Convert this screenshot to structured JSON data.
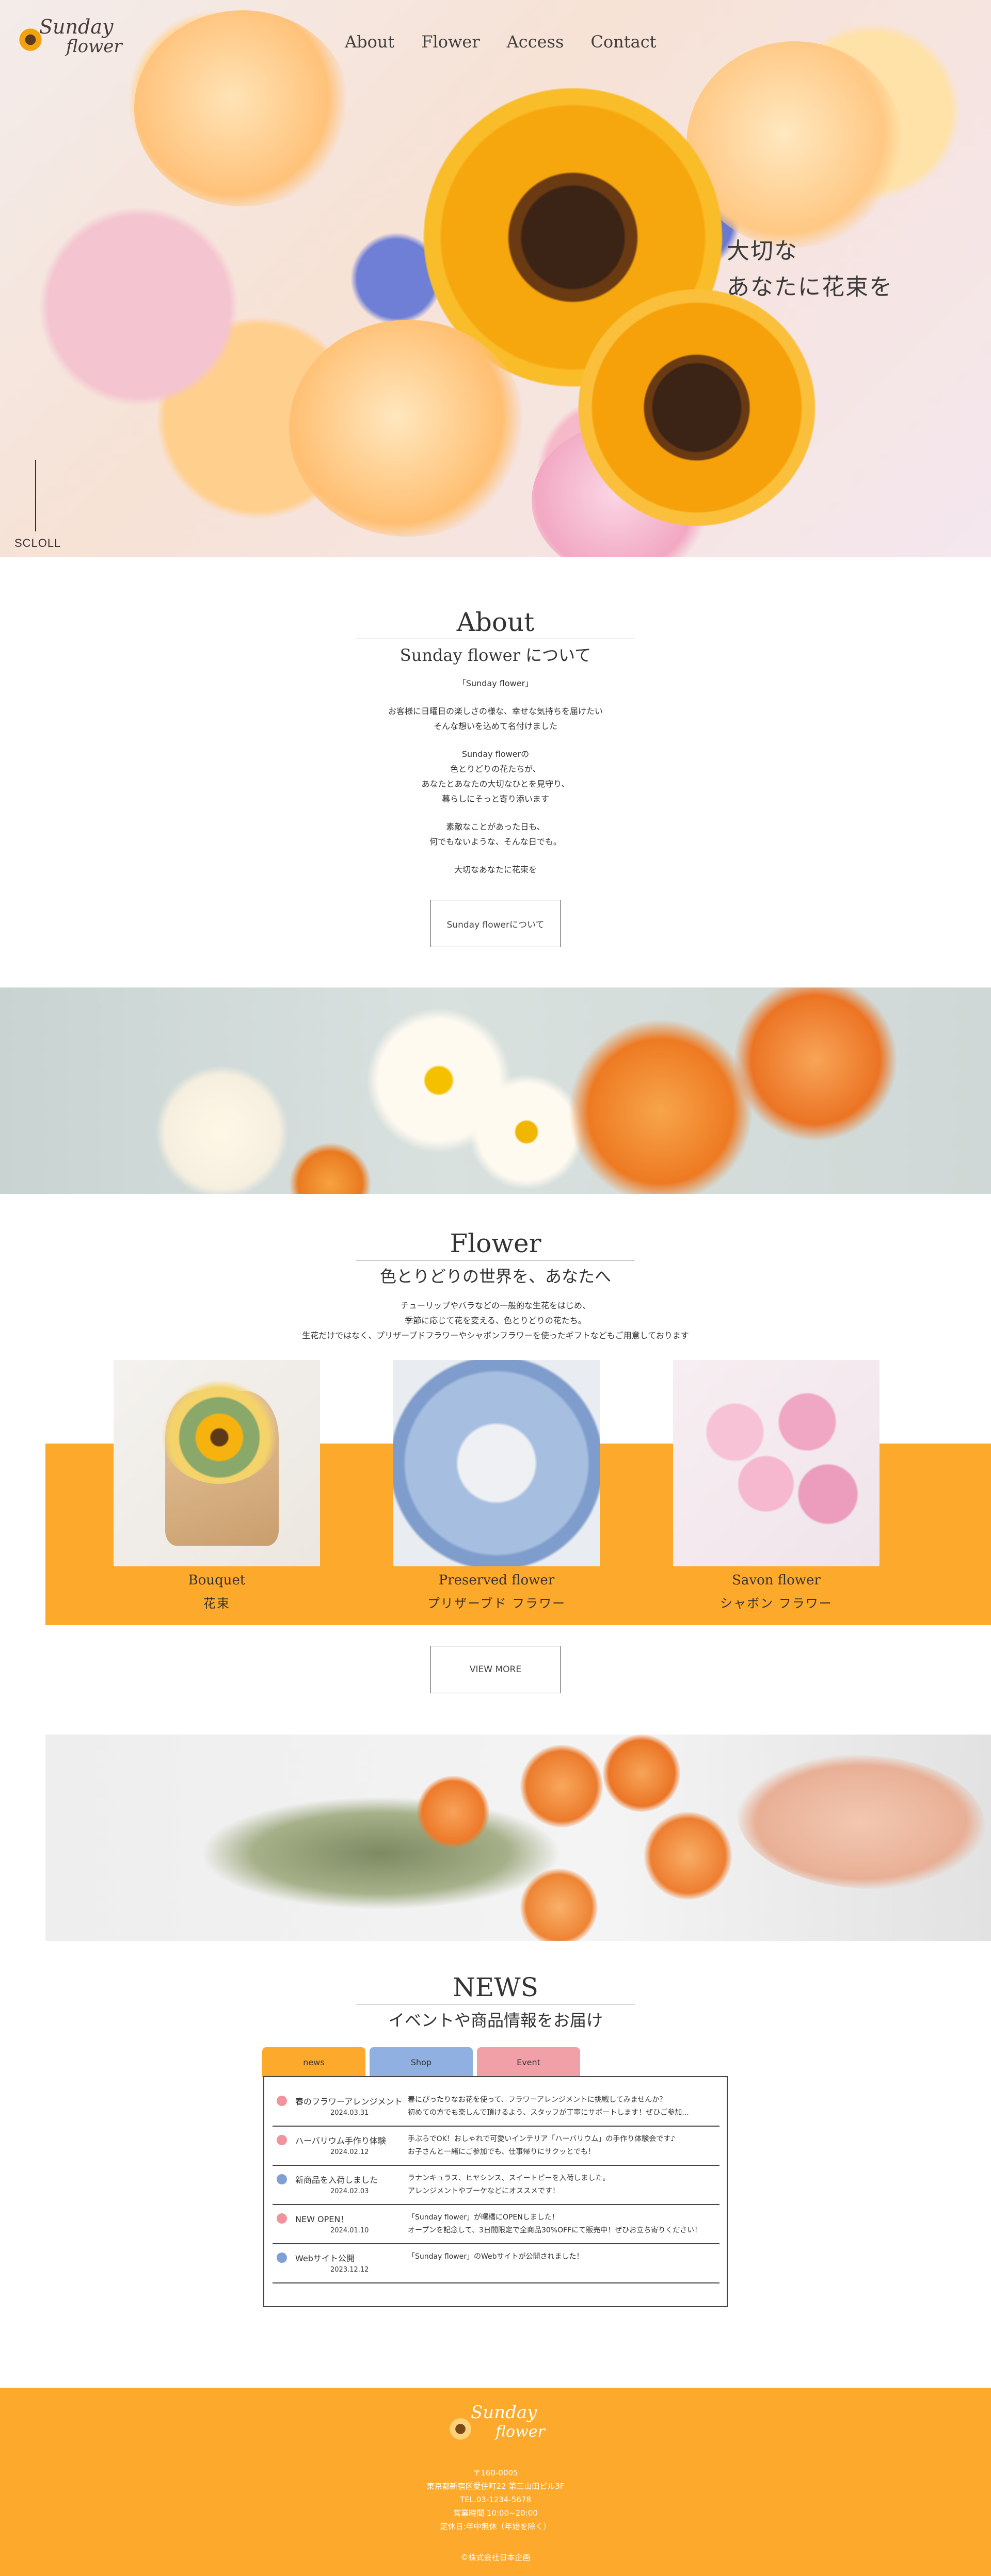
{
  "brand": {
    "logo_line1": "Sunday",
    "logo_line2": "flower"
  },
  "nav": [
    {
      "label": "About"
    },
    {
      "label": "Flower"
    },
    {
      "label": "Access"
    },
    {
      "label": "Contact"
    }
  ],
  "hero": {
    "copy_line1": "大切な",
    "copy_line2": "あなたに花束を",
    "scroll_label": "SCLOLL"
  },
  "about": {
    "title_en": "About",
    "title_ja": "Sunday flower について",
    "paragraphs": [
      [
        "「Sunday flower」"
      ],
      [
        "お客様に日曜日の楽しさの様な、幸せな気持ちを届けたい",
        "そんな想いを込めて名付けました"
      ],
      [
        "Sunday flowerの",
        "色とりどりの花たちが、",
        "あなたとあなたの大切なひとを見守り、",
        "暮らしにそっと寄り添います"
      ],
      [
        "素敵なことがあった日も、",
        "何でもないような、そんな日でも。"
      ],
      [
        "大切なあなたに花束を"
      ]
    ],
    "button_label": "Sunday flowerについて"
  },
  "flower": {
    "title_en": "Flower",
    "title_ja": "色とりどりの世界を、あなたへ",
    "lead": [
      "チューリップやバラなどの一般的な生花をはじめ、",
      "季節に応じて花を変える、色とりどりの花たち。",
      "生花だけではなく、プリザーブドフラワーやシャボンフラワーを使ったギフトなどもご用意しております"
    ],
    "cards": [
      {
        "en": "Bouquet",
        "ja": "花束"
      },
      {
        "en": "Preserved flower",
        "ja": "プリザーブド フラワー"
      },
      {
        "en": "Savon flower",
        "ja": "シャボン フラワー"
      }
    ],
    "button_label": "VIEW MORE"
  },
  "news": {
    "title_en": "NEWS",
    "title_ja": "イベントや商品情報をお届け",
    "tabs": [
      {
        "label": "news",
        "color": "#fda92b"
      },
      {
        "label": "Shop",
        "color": "#8fb0e0"
      },
      {
        "label": "Event",
        "color": "#f2a0a8"
      }
    ],
    "items": [
      {
        "title": "春のフラワーアレンジメント",
        "date": "2024.03.31",
        "body_line1": "春にぴったりなお花を使って、フラワーアレンジメントに挑戦してみませんか？",
        "body_line2": "初めての方でも楽しんで頂けるよう、スタッフが丁寧にサポートします！ぜひご参加...",
        "dot_color": "#f0939c"
      },
      {
        "title": "ハーバリウム手作り体験",
        "date": "2024.02.12",
        "body_line1": "手ぶらでOK！おしゃれで可愛いインテリア「ハーバリウム」の手作り体験会です♪",
        "body_line2": "お子さんと一緒にご参加でも、仕事帰りにサクッとでも！",
        "dot_color": "#f0939c"
      },
      {
        "title": "新商品を入荷しました",
        "date": "2024.02.03",
        "body_line1": "ラナンキュラス、ヒヤシンス、スイートピーを入荷しました。",
        "body_line2": "アレンジメントやブーケなどにオススメです！",
        "dot_color": "#7f9fd6"
      },
      {
        "title": "NEW OPEN！",
        "date": "2024.01.10",
        "body_line1": "「Sunday flower」が曙橋にOPENしました！",
        "body_line2": "オープンを記念して、3日間限定で全商品30%OFFにて販売中！ぜひお立ち寄りください！",
        "dot_color": "#f0939c"
      },
      {
        "title": "Webサイト公開",
        "date": "2023.12.12",
        "body_line1": "「Sunday flower」のWebサイトが公開されました！",
        "body_line2": "",
        "dot_color": "#7f9fd6"
      }
    ]
  },
  "footer": {
    "lines": [
      "〒160-0005",
      "東京都新宿区愛住町22 第三山田ビル3F",
      "TEL.03-1234-5678",
      "営業時間 10:00~20:00",
      "定休日:年中無休（年始を除く）"
    ],
    "copyright": "©株式会社日本企画"
  },
  "colors": {
    "accent": "#fda92b",
    "text": "#333333"
  }
}
